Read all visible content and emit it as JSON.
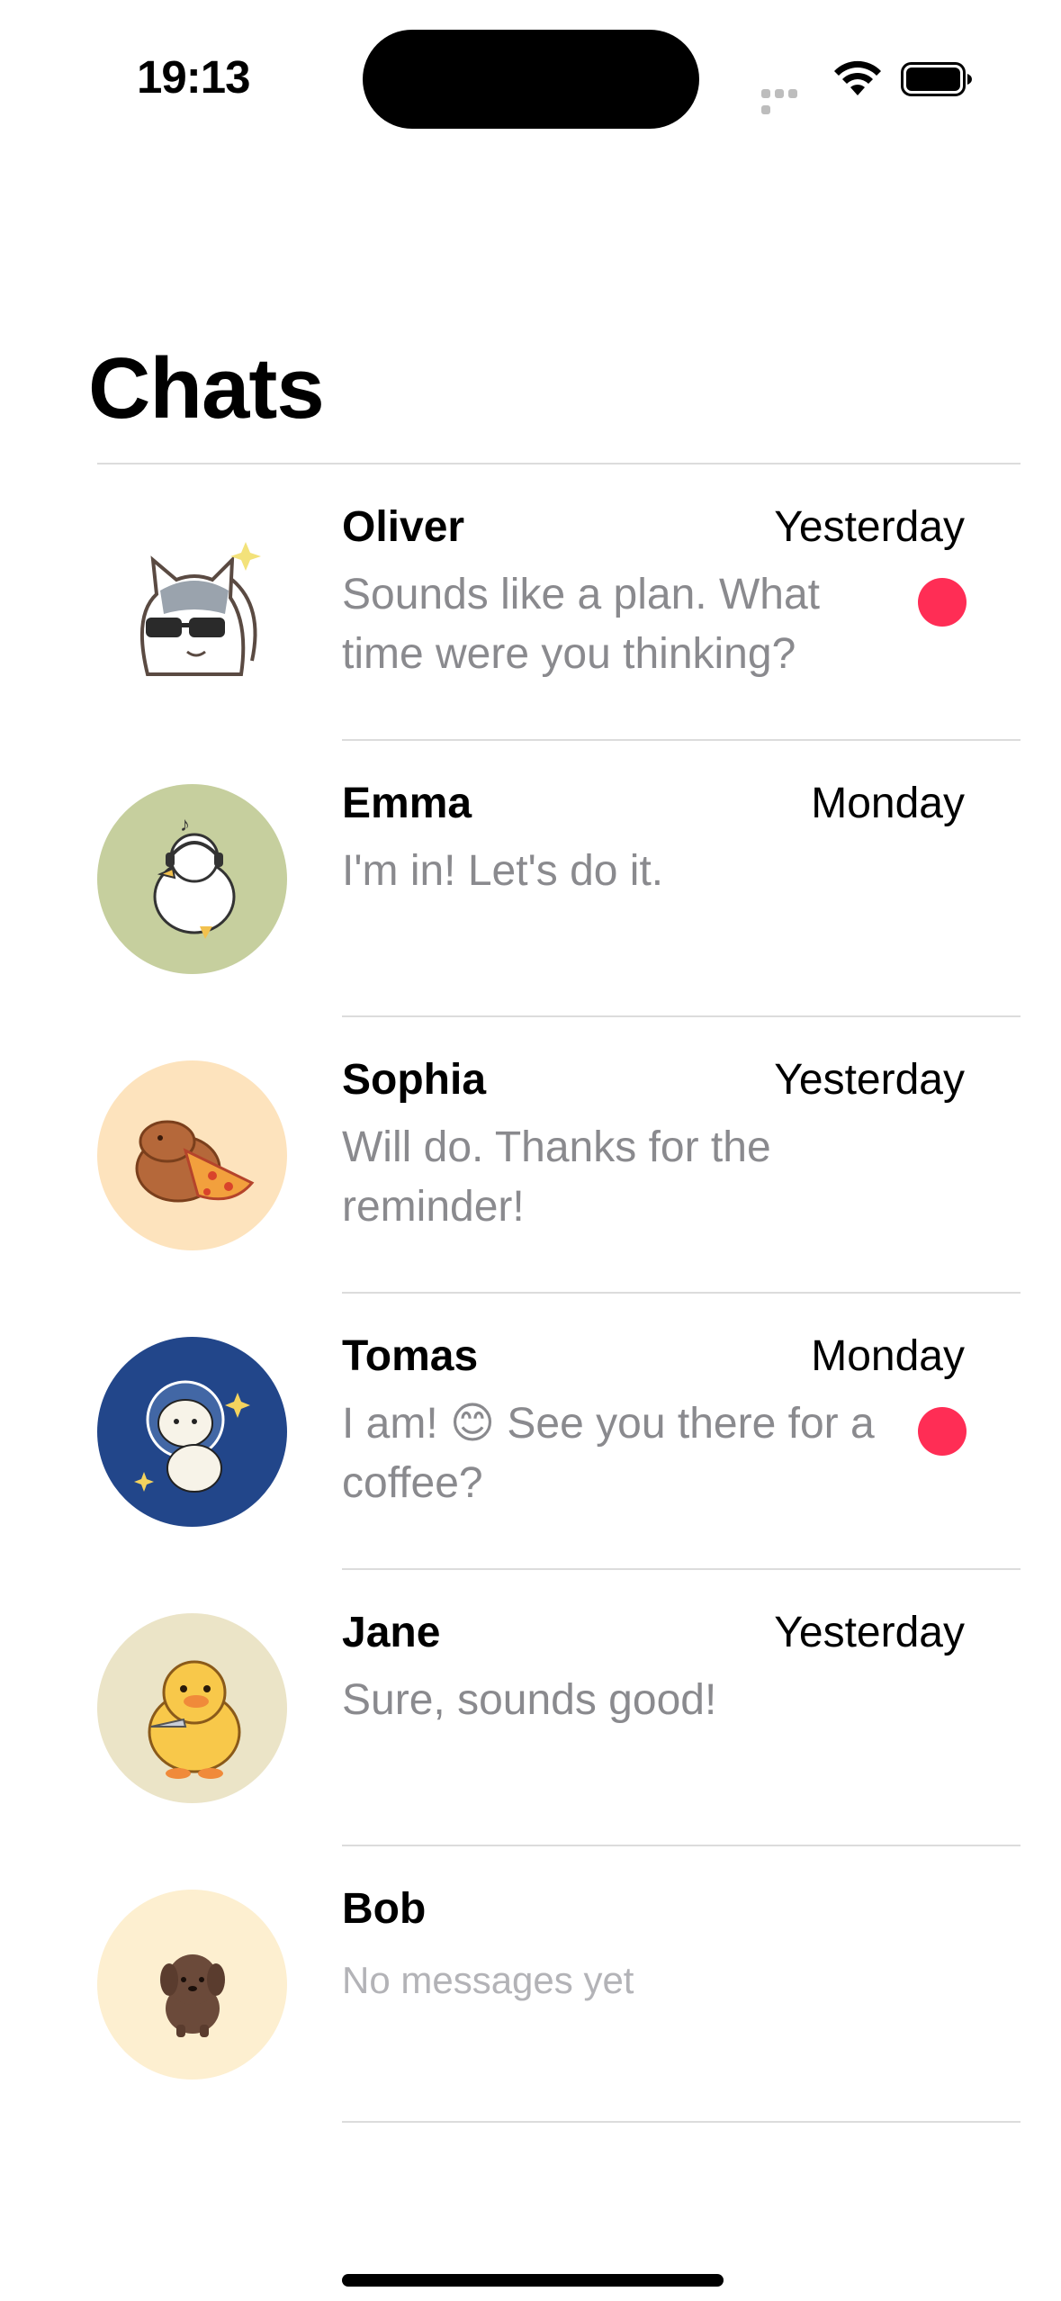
{
  "status_bar": {
    "time": "19:13"
  },
  "title": "Chats",
  "colors": {
    "unread": "#ff2d55",
    "preview_text": "#8a8a8e",
    "divider": "#dcdcdc"
  },
  "chats": [
    {
      "name": "Oliver",
      "time": "Yesterday",
      "preview": "Sounds like a plan. What time were you thinking?",
      "unread": true,
      "avatar": "cat-sunglasses"
    },
    {
      "name": "Emma",
      "time": "Monday",
      "preview": "I'm in! Let's do it.",
      "unread": false,
      "avatar": "duck-headphones"
    },
    {
      "name": "Sophia",
      "time": "Yesterday",
      "preview": "Will do. Thanks for the reminder!",
      "unread": false,
      "avatar": "capybara-pizza"
    },
    {
      "name": "Tomas",
      "time": "Monday",
      "preview": "I am! 😊 See you there for a coffee?",
      "unread": true,
      "avatar": "bear-astronaut"
    },
    {
      "name": "Jane",
      "time": "Yesterday",
      "preview": "Sure, sounds good!",
      "unread": false,
      "avatar": "duckling-knife"
    },
    {
      "name": "Bob",
      "time": "",
      "preview": "No messages yet",
      "unread": false,
      "avatar": "brown-puppy"
    }
  ]
}
